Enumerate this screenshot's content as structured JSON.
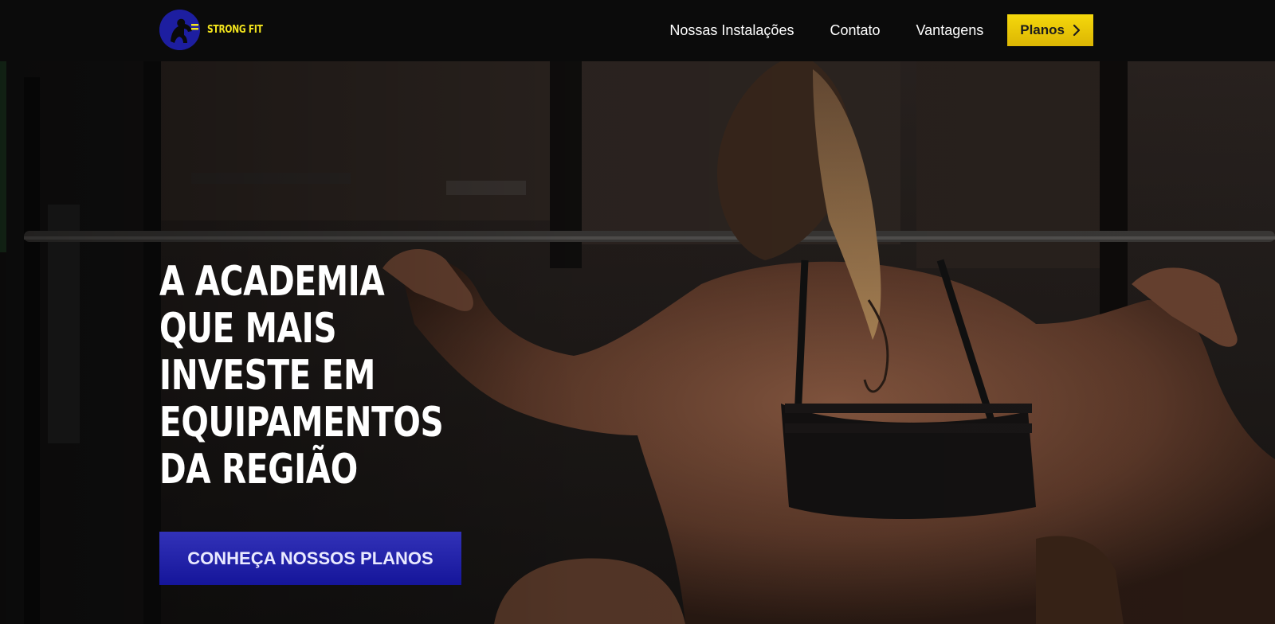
{
  "brand": {
    "name": "STRONG FIT",
    "logo_icon": "athlete-emblem-icon",
    "logo_color": "#1d1ea0",
    "text_color": "#f3e51d"
  },
  "nav": {
    "items": [
      {
        "label": "Nossas Instalações"
      },
      {
        "label": "Contato"
      },
      {
        "label": "Vantagens"
      }
    ],
    "plans_button": {
      "label": "Planos",
      "icon": "chevron-right-icon",
      "color": "#f0cd08"
    }
  },
  "hero": {
    "title": "A ACADEMIA QUE MAIS INVESTE EM EQUIPAMENTOS DA REGIÃO",
    "background": "gym-weightlifting-photo",
    "cta_label": "CONHEÇA NOSSOS PLANOS",
    "cta_color": "#1f1fa8"
  }
}
